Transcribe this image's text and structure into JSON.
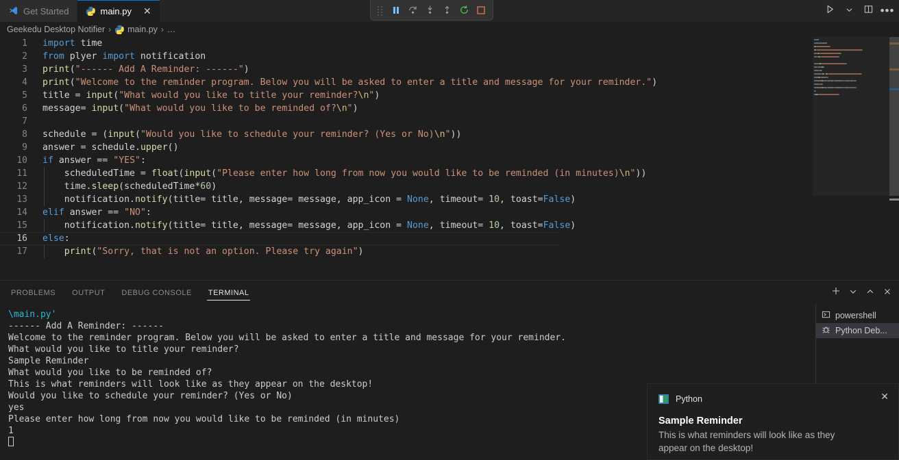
{
  "window": {
    "tabs": [
      {
        "label": "Get Started",
        "icon": "vscode-logo-icon",
        "active": false,
        "closable": false
      },
      {
        "label": "main.py",
        "icon": "python-file-icon",
        "active": true,
        "closable": true,
        "close_glyph": "✕"
      }
    ]
  },
  "debug_toolbar": {
    "buttons": [
      {
        "name": "drag-handle",
        "label": "Drag"
      },
      {
        "name": "pause-button",
        "label": "Pause"
      },
      {
        "name": "step-over-button",
        "label": "Step Over"
      },
      {
        "name": "step-into-button",
        "label": "Step Into"
      },
      {
        "name": "step-out-button",
        "label": "Step Out"
      },
      {
        "name": "restart-button",
        "label": "Restart"
      },
      {
        "name": "stop-button",
        "label": "Stop"
      }
    ]
  },
  "editor_actions": {
    "run_label": "Run Python File",
    "run_dropdown_label": "Run or Debug...",
    "split_label": "Split Editor Right",
    "more_label": "•••"
  },
  "breadcrumb": {
    "items": [
      {
        "label": "Geekedu Desktop Notifier",
        "icon": null
      },
      {
        "label": "main.py",
        "icon": "python-file-icon"
      },
      {
        "label": "…",
        "icon": null
      }
    ],
    "separator": "›"
  },
  "editor": {
    "active_line": 16,
    "lines": [
      {
        "n": 1,
        "indent": false,
        "tokens": [
          {
            "t": "kw",
            "v": "import"
          },
          {
            "t": "id",
            "v": " time"
          }
        ]
      },
      {
        "n": 2,
        "indent": false,
        "tokens": [
          {
            "t": "kw",
            "v": "from"
          },
          {
            "t": "id",
            "v": " plyer "
          },
          {
            "t": "kw",
            "v": "import"
          },
          {
            "t": "id",
            "v": " notification"
          }
        ]
      },
      {
        "n": 3,
        "indent": false,
        "tokens": [
          {
            "t": "fn",
            "v": "print"
          },
          {
            "t": "op",
            "v": "("
          },
          {
            "t": "str",
            "v": "\"------ Add A Reminder: ------\""
          },
          {
            "t": "op",
            "v": ")"
          }
        ]
      },
      {
        "n": 4,
        "indent": false,
        "tokens": [
          {
            "t": "fn",
            "v": "print"
          },
          {
            "t": "op",
            "v": "("
          },
          {
            "t": "str",
            "v": "\"Welcome to the reminder program. Below you will be asked to enter a title and message for your reminder.\""
          },
          {
            "t": "op",
            "v": ")"
          }
        ]
      },
      {
        "n": 5,
        "indent": false,
        "tokens": [
          {
            "t": "id",
            "v": "title "
          },
          {
            "t": "op",
            "v": "= "
          },
          {
            "t": "fn",
            "v": "input"
          },
          {
            "t": "op",
            "v": "("
          },
          {
            "t": "str",
            "v": "\"What would you like to title your reminder?"
          },
          {
            "t": "esc",
            "v": "\\n"
          },
          {
            "t": "str",
            "v": "\""
          },
          {
            "t": "op",
            "v": ")"
          }
        ]
      },
      {
        "n": 6,
        "indent": false,
        "tokens": [
          {
            "t": "id",
            "v": "message"
          },
          {
            "t": "op",
            "v": "= "
          },
          {
            "t": "fn",
            "v": "input"
          },
          {
            "t": "op",
            "v": "("
          },
          {
            "t": "str",
            "v": "\"What would you like to be reminded of?"
          },
          {
            "t": "esc",
            "v": "\\n"
          },
          {
            "t": "str",
            "v": "\""
          },
          {
            "t": "op",
            "v": ")"
          }
        ]
      },
      {
        "n": 7,
        "indent": false,
        "tokens": []
      },
      {
        "n": 8,
        "indent": false,
        "tokens": [
          {
            "t": "id",
            "v": "schedule "
          },
          {
            "t": "op",
            "v": "= ("
          },
          {
            "t": "fn",
            "v": "input"
          },
          {
            "t": "op",
            "v": "("
          },
          {
            "t": "str",
            "v": "\"Would you like to schedule your reminder? (Yes or No)"
          },
          {
            "t": "esc",
            "v": "\\n"
          },
          {
            "t": "str",
            "v": "\""
          },
          {
            "t": "op",
            "v": "))"
          }
        ]
      },
      {
        "n": 9,
        "indent": false,
        "tokens": [
          {
            "t": "id",
            "v": "answer "
          },
          {
            "t": "op",
            "v": "= "
          },
          {
            "t": "id",
            "v": "schedule."
          },
          {
            "t": "fn",
            "v": "upper"
          },
          {
            "t": "op",
            "v": "()"
          }
        ]
      },
      {
        "n": 10,
        "indent": false,
        "tokens": [
          {
            "t": "kw",
            "v": "if"
          },
          {
            "t": "id",
            "v": " answer "
          },
          {
            "t": "op",
            "v": "== "
          },
          {
            "t": "str",
            "v": "\"YES\""
          },
          {
            "t": "op",
            "v": ":"
          }
        ]
      },
      {
        "n": 11,
        "indent": true,
        "tokens": [
          {
            "t": "id",
            "v": "    scheduledTime "
          },
          {
            "t": "op",
            "v": "= "
          },
          {
            "t": "fn",
            "v": "float"
          },
          {
            "t": "op",
            "v": "("
          },
          {
            "t": "fn",
            "v": "input"
          },
          {
            "t": "op",
            "v": "("
          },
          {
            "t": "str",
            "v": "\"Please enter how long from now you would like to be reminded (in minutes)"
          },
          {
            "t": "esc",
            "v": "\\n"
          },
          {
            "t": "str",
            "v": "\""
          },
          {
            "t": "op",
            "v": "))"
          }
        ]
      },
      {
        "n": 12,
        "indent": true,
        "tokens": [
          {
            "t": "id",
            "v": "    time."
          },
          {
            "t": "fn",
            "v": "sleep"
          },
          {
            "t": "op",
            "v": "("
          },
          {
            "t": "id",
            "v": "scheduledTime"
          },
          {
            "t": "op",
            "v": "*"
          },
          {
            "t": "num",
            "v": "60"
          },
          {
            "t": "op",
            "v": ")"
          }
        ]
      },
      {
        "n": 13,
        "indent": true,
        "tokens": [
          {
            "t": "id",
            "v": "    notification."
          },
          {
            "t": "fn",
            "v": "notify"
          },
          {
            "t": "op",
            "v": "("
          },
          {
            "t": "id",
            "v": "title"
          },
          {
            "t": "op",
            "v": "= "
          },
          {
            "t": "id",
            "v": "title, "
          },
          {
            "t": "id",
            "v": "message"
          },
          {
            "t": "op",
            "v": "= "
          },
          {
            "t": "id",
            "v": "message, app_icon "
          },
          {
            "t": "op",
            "v": "= "
          },
          {
            "t": "const",
            "v": "None"
          },
          {
            "t": "op",
            "v": ", "
          },
          {
            "t": "id",
            "v": "timeout"
          },
          {
            "t": "op",
            "v": "= "
          },
          {
            "t": "num",
            "v": "10"
          },
          {
            "t": "op",
            "v": ", "
          },
          {
            "t": "id",
            "v": "toast"
          },
          {
            "t": "op",
            "v": "="
          },
          {
            "t": "const",
            "v": "False"
          },
          {
            "t": "op",
            "v": ")"
          }
        ]
      },
      {
        "n": 14,
        "indent": false,
        "tokens": [
          {
            "t": "kw",
            "v": "elif"
          },
          {
            "t": "id",
            "v": " answer "
          },
          {
            "t": "op",
            "v": "== "
          },
          {
            "t": "str",
            "v": "\"NO\""
          },
          {
            "t": "op",
            "v": ":"
          }
        ]
      },
      {
        "n": 15,
        "indent": true,
        "tokens": [
          {
            "t": "id",
            "v": "    notification."
          },
          {
            "t": "fn",
            "v": "notify"
          },
          {
            "t": "op",
            "v": "("
          },
          {
            "t": "id",
            "v": "title"
          },
          {
            "t": "op",
            "v": "= "
          },
          {
            "t": "id",
            "v": "title, "
          },
          {
            "t": "id",
            "v": "message"
          },
          {
            "t": "op",
            "v": "= "
          },
          {
            "t": "id",
            "v": "message, app_icon "
          },
          {
            "t": "op",
            "v": "= "
          },
          {
            "t": "const",
            "v": "None"
          },
          {
            "t": "op",
            "v": ", "
          },
          {
            "t": "id",
            "v": "timeout"
          },
          {
            "t": "op",
            "v": "= "
          },
          {
            "t": "num",
            "v": "10"
          },
          {
            "t": "op",
            "v": ", "
          },
          {
            "t": "id",
            "v": "toast"
          },
          {
            "t": "op",
            "v": "="
          },
          {
            "t": "const",
            "v": "False"
          },
          {
            "t": "op",
            "v": ")"
          }
        ]
      },
      {
        "n": 16,
        "indent": false,
        "tokens": [
          {
            "t": "kw",
            "v": "else"
          },
          {
            "t": "op",
            "v": ":"
          }
        ]
      },
      {
        "n": 17,
        "indent": true,
        "tokens": [
          {
            "t": "id",
            "v": "    "
          },
          {
            "t": "fn",
            "v": "print"
          },
          {
            "t": "op",
            "v": "("
          },
          {
            "t": "str",
            "v": "\"Sorry, that is not an option. Please try again\""
          },
          {
            "t": "op",
            "v": ")"
          }
        ]
      }
    ]
  },
  "panel": {
    "tabs": [
      {
        "label": "PROBLEMS",
        "active": false
      },
      {
        "label": "OUTPUT",
        "active": false
      },
      {
        "label": "DEBUG CONSOLE",
        "active": false
      },
      {
        "label": "TERMINAL",
        "active": true
      }
    ],
    "actions": [
      {
        "name": "new-terminal-button",
        "glyph": "+"
      },
      {
        "name": "terminal-dropdown-button",
        "glyph": "chevron-down-icon"
      },
      {
        "name": "maximize-panel-button",
        "glyph": "chevron-up-icon"
      },
      {
        "name": "close-panel-button",
        "glyph": "close-icon"
      }
    ],
    "terminal_output": [
      {
        "text": "\\main.py'",
        "color": "cyan"
      },
      {
        "text": "------ Add A Reminder: ------",
        "color": "default"
      },
      {
        "text": "Welcome to the reminder program. Below you will be asked to enter a title and message for your reminder.",
        "color": "default"
      },
      {
        "text": "What would you like to title your reminder?",
        "color": "default"
      },
      {
        "text": "Sample Reminder",
        "color": "default"
      },
      {
        "text": "What would you like to be reminded of?",
        "color": "default"
      },
      {
        "text": "This is what reminders will look like as they appear on the desktop!",
        "color": "default"
      },
      {
        "text": "Would you like to schedule your reminder? (Yes or No)",
        "color": "default"
      },
      {
        "text": "yes",
        "color": "default"
      },
      {
        "text": "Please enter how long from now you would like to be reminded (in minutes)",
        "color": "default"
      },
      {
        "text": "1",
        "color": "default"
      }
    ],
    "terminal_list": [
      {
        "label": "powershell",
        "icon": "terminal-icon",
        "selected": false
      },
      {
        "label": "Python Deb...",
        "icon": "debug-bug-icon",
        "selected": true
      }
    ]
  },
  "toast": {
    "app_name": "Python",
    "app_icon": "python-app-icon",
    "close_glyph": "✕",
    "title": "Sample Reminder",
    "body": "This is what reminders will look like as they appear on the desktop!"
  },
  "colors": {
    "accent": "#0078d4",
    "editor_bg": "#1e1e1e",
    "tabbar_bg": "#252526",
    "keyword": "#569cd6",
    "string": "#ce9178",
    "function": "#dcdcaa",
    "number": "#b5cea8",
    "selection": "#37373d",
    "stop_red": "#e06c56",
    "restart_green": "#4ec94e"
  }
}
